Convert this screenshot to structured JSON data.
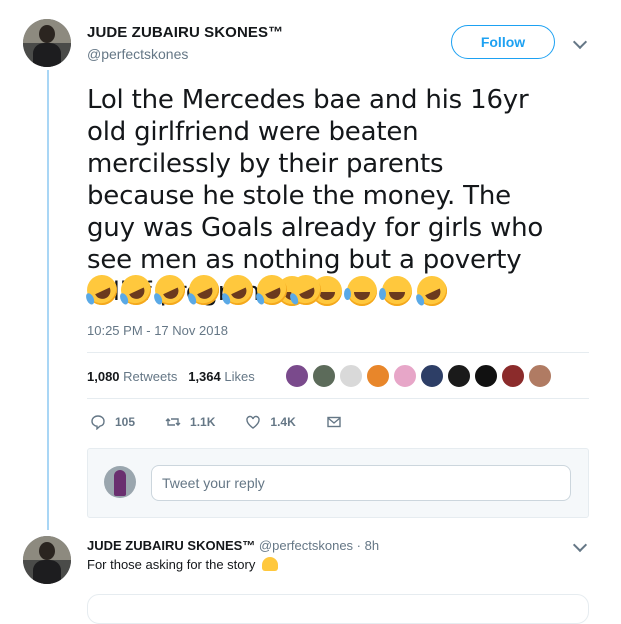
{
  "tweet": {
    "author_name": "JUDE ZUBAIRU SKONES™",
    "author_handle": "@perfectskones",
    "follow_label": "Follow",
    "text": "Lol the Mercedes bae and his 16yr old girlfriend were beaten mercilessly by their parents because he stole the money. The guy was Goals already for girls who see men as nothing but a poverty relief program ",
    "timestamp": "10:25 PM - 17 Nov 2018",
    "retweets_count": "1,080",
    "retweets_label": "Retweets",
    "likes_count": "1,364",
    "likes_label": "Likes",
    "reply_count": "105",
    "retweet_action_count": "1.1K",
    "like_action_count": "1.4K"
  },
  "reply_composer": {
    "placeholder": "Tweet your reply"
  },
  "reply_tweet": {
    "author_name": "JUDE ZUBAIRU SKONES™",
    "author_handle": "@perfectskones · 8h",
    "text": "For those asking for the story "
  },
  "icons": {
    "reply": "reply-icon",
    "retweet": "retweet-icon",
    "like": "heart-icon",
    "message": "envelope-icon",
    "more": "chevron-down-icon"
  },
  "colors": {
    "accent": "#1da1f2",
    "thread_line": "#a9d6f5",
    "muted_text": "#657786"
  }
}
